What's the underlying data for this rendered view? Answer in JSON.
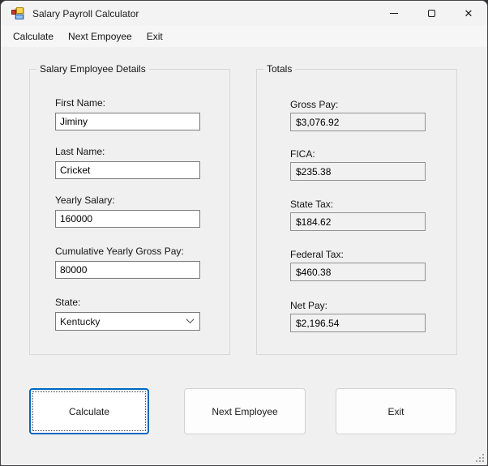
{
  "window": {
    "title": "Salary Payroll Calculator"
  },
  "icons": {
    "app": "winforms-form-icon",
    "minimize": "minimize-dash",
    "maximize": "maximize-square",
    "close": "✕",
    "combo_chevron": "chevron-down",
    "resize_grip": "size-grip-dots"
  },
  "menu": {
    "items": [
      {
        "label": "Calculate"
      },
      {
        "label": "Next Empoyee"
      },
      {
        "label": "Exit"
      }
    ]
  },
  "employee_details": {
    "title": "Salary Employee Details",
    "fields": [
      {
        "label": "First Name:",
        "value": "Jiminy"
      },
      {
        "label": "Last Name:",
        "value": "Cricket"
      },
      {
        "label": "Yearly Salary:",
        "value": "160000"
      },
      {
        "label": "Cumulative Yearly Gross Pay:",
        "value": "80000"
      },
      {
        "label": "State:",
        "value": "Kentucky"
      }
    ]
  },
  "totals": {
    "title": "Totals",
    "fields": [
      {
        "label": "Gross Pay:",
        "value": "$3,076.92"
      },
      {
        "label": "FICA:",
        "value": "$235.38"
      },
      {
        "label": "State Tax:",
        "value": "$184.62"
      },
      {
        "label": "Federal Tax:",
        "value": "$460.38"
      },
      {
        "label": "Net Pay:",
        "value": "$2,196.54"
      }
    ]
  },
  "buttons": {
    "calculate": "Calculate",
    "next_employee": "Next Employee",
    "exit": "Exit"
  },
  "colors": {
    "accent_focus_border": "#0067c0",
    "titlebar_bg": "#f3f3f4",
    "menubar_bg": "#f6f6f6",
    "client_bg": "#f0f0f0",
    "textbox_border": "#7a7a7a",
    "readonly_bg": "#f1f1f1",
    "groupbox_border": "#d7d7d7",
    "button_border": "#d1d1d1"
  }
}
